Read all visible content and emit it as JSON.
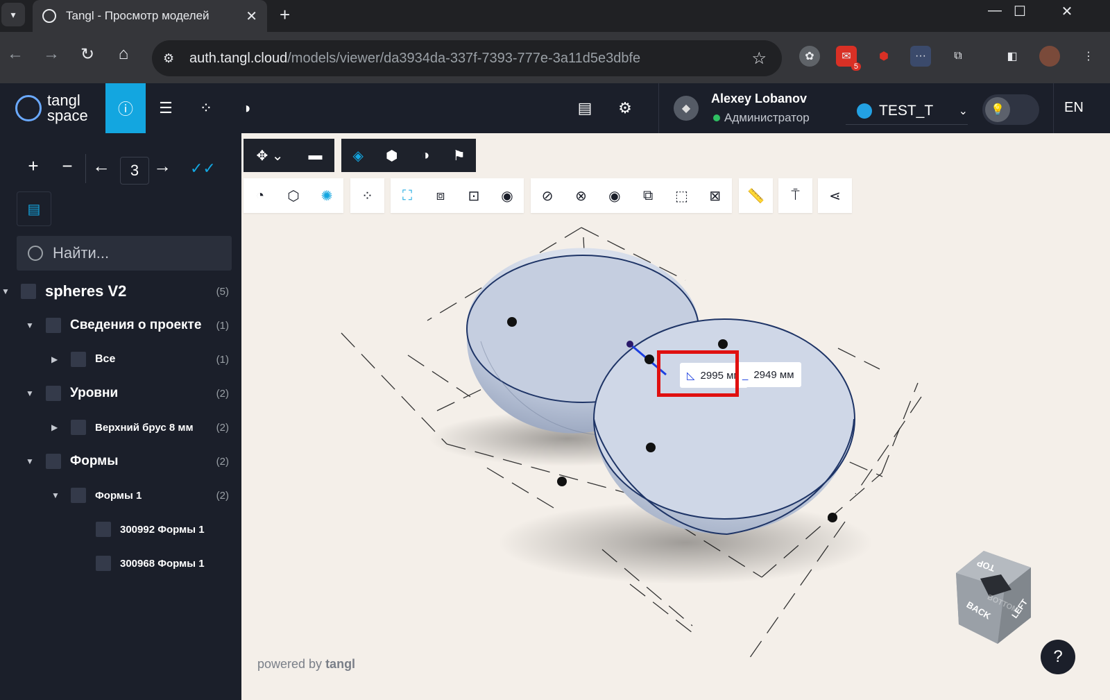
{
  "browser": {
    "tab_title": "Tangl - Просмотр моделей",
    "url_host": "auth.tangl.cloud",
    "url_path": "/models/viewer/da3934da-337f-7393-777e-3a11d5e3dbfe",
    "extension_badge": "5"
  },
  "header": {
    "logo_line1": "tangl",
    "logo_line2": "space",
    "user_name": "Alexey Lobanov",
    "user_role": "Администратор",
    "workspace": "TEST_T",
    "language": "EN"
  },
  "sidebar": {
    "level_value": "3",
    "search_placeholder": "Найти...",
    "tree": [
      {
        "label": "spheres V2",
        "count": "(5)"
      },
      {
        "label": "Сведения о проекте",
        "count": "(1)"
      },
      {
        "label": "Все",
        "count": "(1)"
      },
      {
        "label": "Уровни",
        "count": "(2)"
      },
      {
        "label": "Верхний брус 8 мм",
        "count": "(2)"
      },
      {
        "label": "Формы",
        "count": "(2)"
      },
      {
        "label": "Формы 1",
        "count": "(2)"
      },
      {
        "label": "300992  Формы 1",
        "count": ""
      },
      {
        "label": "300968  Формы 1",
        "count": ""
      }
    ]
  },
  "viewer": {
    "measure_1": "2995 мм",
    "measure_2": "2949 мм",
    "powered_prefix": "powered by ",
    "powered_brand": "tangl",
    "cube_labels": {
      "top": "TOP",
      "back": "BACK",
      "left": "LEFT",
      "bottom": "BOTTOM"
    },
    "help": "?"
  },
  "colors": {
    "accent": "#13a6e0",
    "header_bg": "#1b1f2a",
    "viewport_bg": "#f4efe9",
    "highlight": "#e01010"
  }
}
